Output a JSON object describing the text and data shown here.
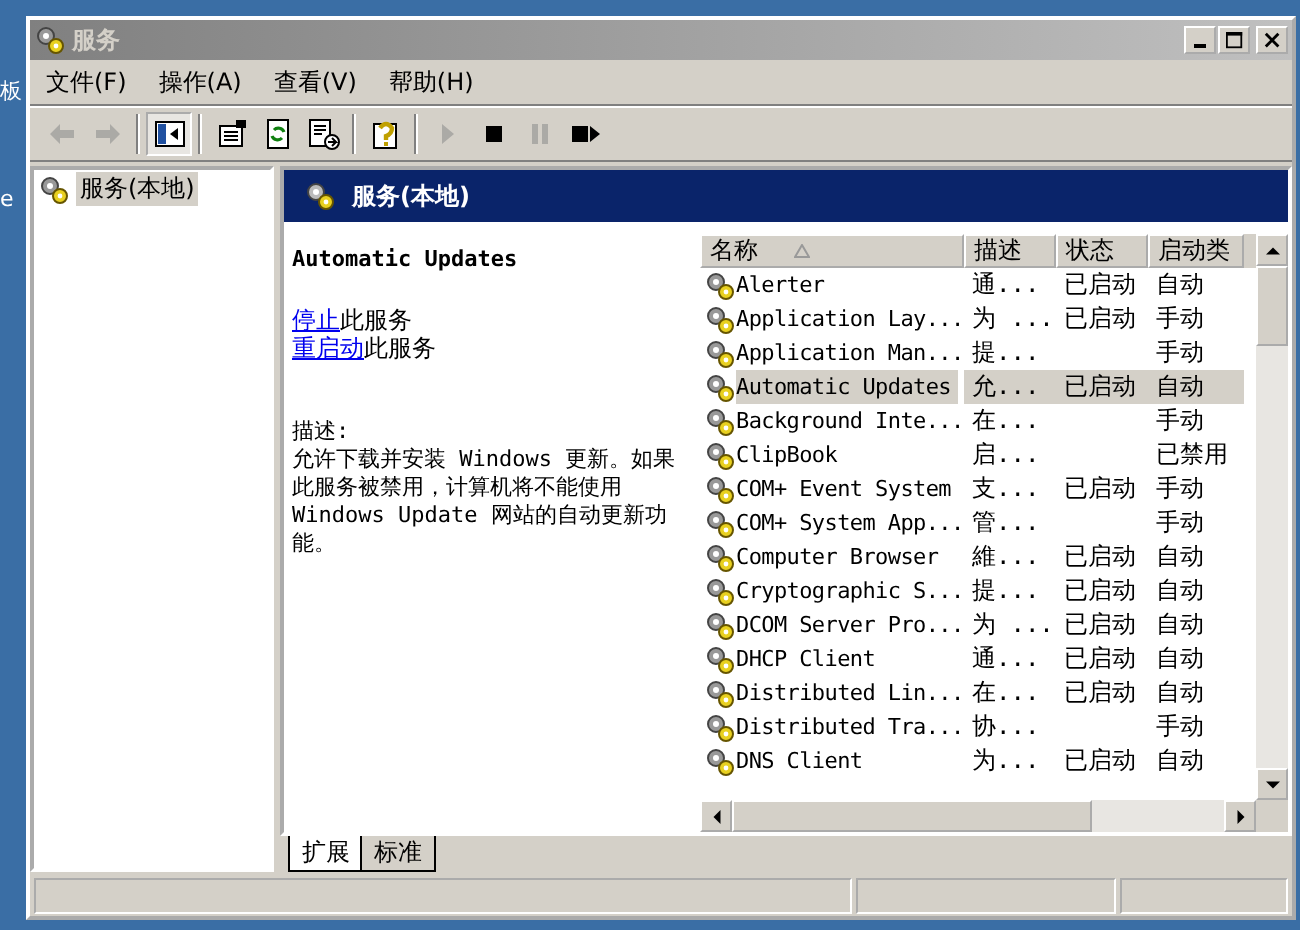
{
  "desktop_labels": [
    "板",
    "e"
  ],
  "window": {
    "title": "服务"
  },
  "menu": [
    "文件(F)",
    "操作(A)",
    "查看(V)",
    "帮助(H)"
  ],
  "toolbar": [
    {
      "kind": "back",
      "disabled": true
    },
    {
      "kind": "forward",
      "disabled": true
    },
    {
      "kind": "sep"
    },
    {
      "kind": "tree",
      "disabled": false
    },
    {
      "kind": "sep"
    },
    {
      "kind": "properties",
      "disabled": false
    },
    {
      "kind": "refresh",
      "disabled": false
    },
    {
      "kind": "export",
      "disabled": false
    },
    {
      "kind": "sep"
    },
    {
      "kind": "help",
      "disabled": false
    },
    {
      "kind": "sep"
    },
    {
      "kind": "play",
      "disabled": true
    },
    {
      "kind": "stop",
      "disabled": false
    },
    {
      "kind": "pause",
      "disabled": true
    },
    {
      "kind": "restart",
      "disabled": false
    }
  ],
  "tree": {
    "items": [
      {
        "label": "服务(本地)",
        "selected": true
      }
    ]
  },
  "header": {
    "title": "服务(本地)"
  },
  "details": {
    "service_name": "Automatic Updates",
    "actions": [
      {
        "link": "停止",
        "text": "此服务"
      },
      {
        "link": "重启动",
        "text": "此服务"
      }
    ],
    "description_label": "描述:",
    "description": "允许下载并安装 Windows 更新。如果此服务被禁用，计算机将不能使用 Windows Update 网站的自动更新功能。"
  },
  "table": {
    "columns": [
      {
        "label": "名称",
        "sorted": true
      },
      {
        "label": "描述",
        "sorted": false
      },
      {
        "label": "状态",
        "sorted": false
      },
      {
        "label": "启动类",
        "sorted": false
      }
    ],
    "rows": [
      {
        "name": "Alerter",
        "description": "通...",
        "status": "已启动",
        "startup": "自动",
        "selected": false
      },
      {
        "name": "Application Lay...",
        "description": "为 ...",
        "status": "已启动",
        "startup": "手动",
        "selected": false
      },
      {
        "name": "Application Man...",
        "description": "提...",
        "status": "",
        "startup": "手动",
        "selected": false
      },
      {
        "name": "Automatic Updates",
        "description": "允...",
        "status": "已启动",
        "startup": "自动",
        "selected": true
      },
      {
        "name": "Background Inte...",
        "description": "在...",
        "status": "",
        "startup": "手动",
        "selected": false
      },
      {
        "name": "ClipBook",
        "description": "启...",
        "status": "",
        "startup": "已禁用",
        "selected": false
      },
      {
        "name": "COM+ Event System",
        "description": "支...",
        "status": "已启动",
        "startup": "手动",
        "selected": false
      },
      {
        "name": "COM+ System App...",
        "description": "管...",
        "status": "",
        "startup": "手动",
        "selected": false
      },
      {
        "name": "Computer Browser",
        "description": "維...",
        "status": "已启动",
        "startup": "自动",
        "selected": false
      },
      {
        "name": "Cryptographic S...",
        "description": "提...",
        "status": "已启动",
        "startup": "自动",
        "selected": false
      },
      {
        "name": "DCOM Server Pro...",
        "description": "为 ...",
        "status": "已启动",
        "startup": "自动",
        "selected": false
      },
      {
        "name": "DHCP Client",
        "description": "通...",
        "status": "已启动",
        "startup": "自动",
        "selected": false
      },
      {
        "name": "Distributed Lin...",
        "description": "在...",
        "status": "已启动",
        "startup": "自动",
        "selected": false
      },
      {
        "name": "Distributed Tra...",
        "description": "协...",
        "status": "",
        "startup": "手动",
        "selected": false
      },
      {
        "name": "DNS Client",
        "description": "为...",
        "status": "已启动",
        "startup": "自动",
        "selected": false
      }
    ]
  },
  "tabs": [
    {
      "label": "扩展",
      "selected": true
    },
    {
      "label": "标准",
      "selected": false
    }
  ]
}
